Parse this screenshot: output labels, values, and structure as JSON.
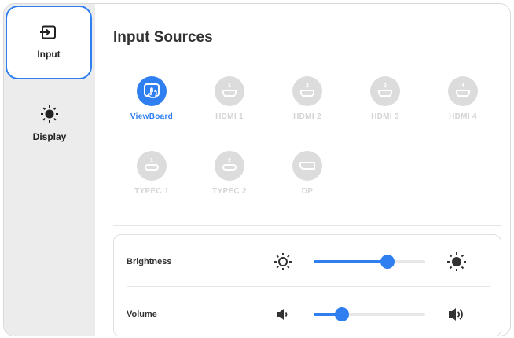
{
  "sidebar": {
    "items": [
      {
        "label": "Input",
        "icon": "input-icon",
        "active": true
      },
      {
        "label": "Display",
        "icon": "sun-icon",
        "active": false
      }
    ]
  },
  "main": {
    "title": "Input Sources",
    "sources": [
      {
        "label": "ViewBoard",
        "number": "",
        "active": true
      },
      {
        "label": "HDMI 1",
        "number": "1",
        "active": false
      },
      {
        "label": "HDMI 2",
        "number": "2",
        "active": false
      },
      {
        "label": "HDMI 3",
        "number": "3",
        "active": false
      },
      {
        "label": "HDMI 4",
        "number": "4",
        "active": false
      },
      {
        "label": "TYPEC 1",
        "number": "1",
        "active": false
      },
      {
        "label": "TYPEC 2",
        "number": "2",
        "active": false
      },
      {
        "label": "DP",
        "number": "",
        "active": false
      }
    ],
    "settings": {
      "brightness": {
        "label": "Brightness",
        "value_fraction": 0.66
      },
      "volume": {
        "label": "Volume",
        "value_fraction": 0.25
      }
    }
  },
  "colors": {
    "accent": "#2f7ff0",
    "inactive": "#dcdcdc",
    "sidebar": "#ececec"
  }
}
